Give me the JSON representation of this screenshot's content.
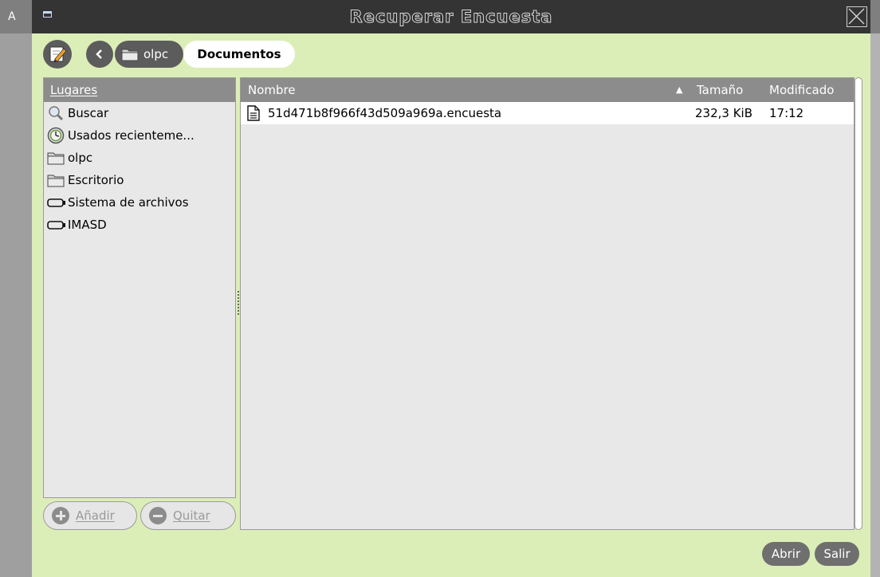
{
  "background_app": {
    "fragment_text": "A"
  },
  "window": {
    "title": "Recuperar Encuesta"
  },
  "pathbar": {
    "crumbs": [
      {
        "label": "olpc",
        "icon": "folder-icon"
      },
      {
        "label": "Documentos"
      }
    ]
  },
  "places": {
    "header": "Lugares",
    "items": [
      {
        "label": "Buscar",
        "icon": "search-icon"
      },
      {
        "label": "Usados recienteme...",
        "icon": "recent-icon"
      },
      {
        "label": "olpc",
        "icon": "folder-icon"
      },
      {
        "label": "Escritorio",
        "icon": "folder-icon"
      },
      {
        "label": "Sistema de archivos",
        "icon": "drive-icon"
      },
      {
        "label": "IMASD",
        "icon": "drive-icon"
      }
    ],
    "add_label": "Añadir",
    "remove_label": "Quitar"
  },
  "files": {
    "columns": {
      "name": "Nombre",
      "size": "Tamaño",
      "modified": "Modificado"
    },
    "sort_indicator": "▲",
    "rows": [
      {
        "name": "51d471b8f966f43d509a969a.encuesta",
        "size": "232,3 KiB",
        "modified": "17:12",
        "icon": "document-icon"
      }
    ]
  },
  "actions": {
    "open_label": "Abrir",
    "quit_label": "Salir"
  },
  "colors": {
    "dialog_bg": "#dceeb7",
    "titlebar": "#343434",
    "header_bg": "#8c8c8c",
    "button_dark": "#5c5c5c"
  }
}
